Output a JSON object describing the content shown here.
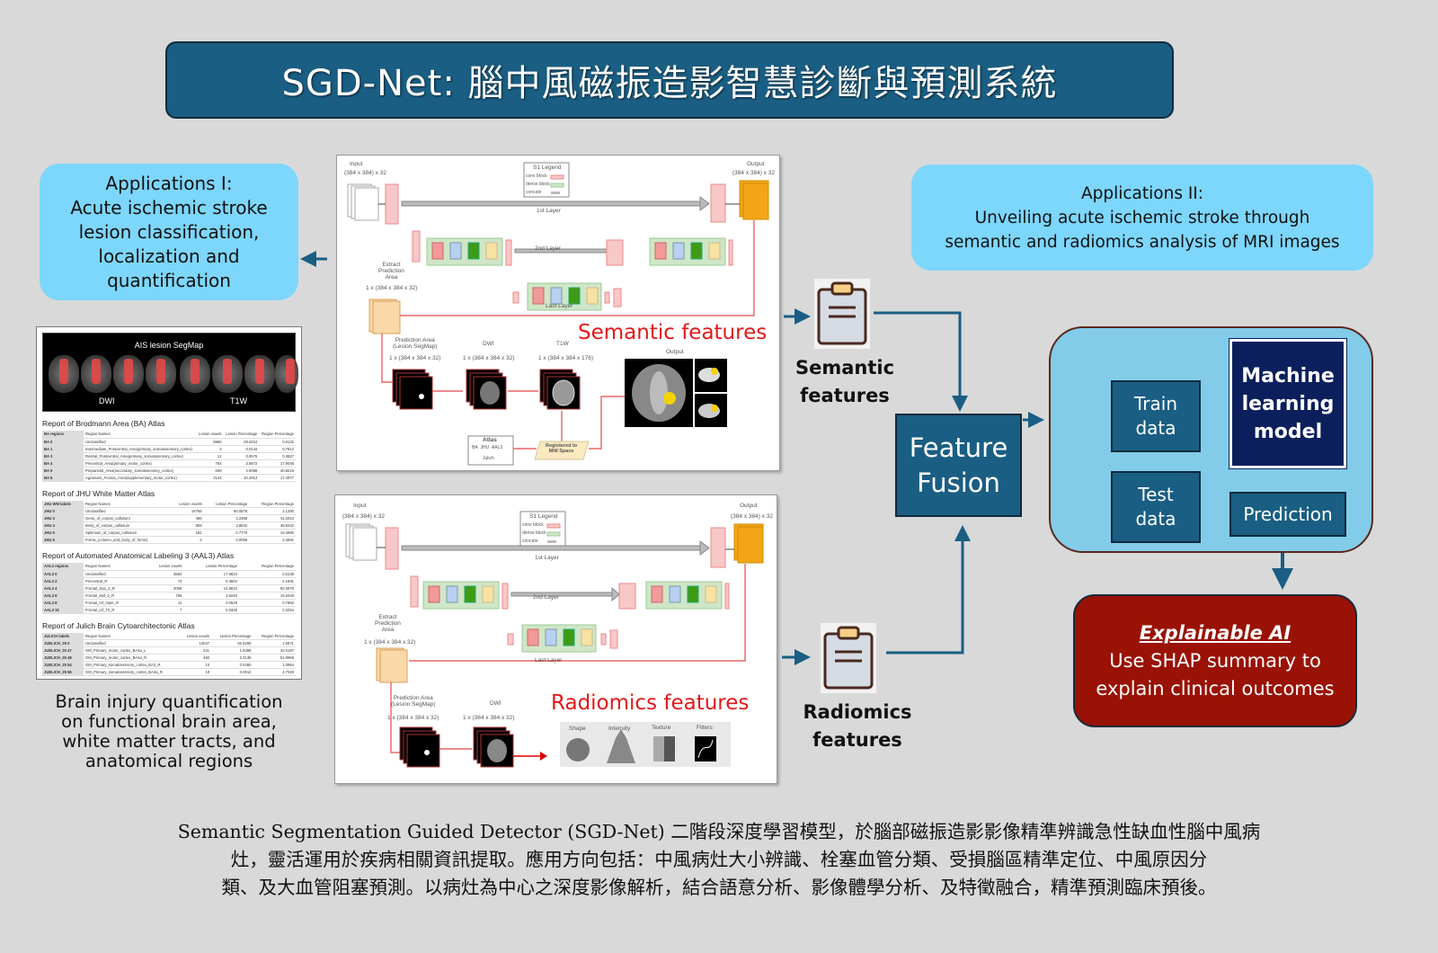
{
  "title": "SGD-Net: 腦中風磁振造影智慧診斷與預測系統",
  "applications_1": {
    "lines": [
      "Applications I:",
      "Acute ischemic stroke",
      "lesion classification,",
      "localization and",
      "quantification"
    ]
  },
  "applications_2": {
    "lines": [
      "Applications II:",
      "Unveiling acute ischemic stroke through",
      "semantic and radiomics analysis of MRI images"
    ]
  },
  "report": {
    "segmap_title": "AIS lesion SegMap",
    "segmap_labels": [
      "DWI",
      "T1W"
    ],
    "tables": [
      {
        "title": "Report of Brodmann Area (BA) Atlas",
        "columns": [
          "BA regions",
          "Region Names",
          "Lesion voxels",
          "Lesion Percentage",
          "Region Percentage"
        ],
        "rows": [
          [
            "BA 0",
            "Unclassified",
            "5965",
            "28.6324",
            "0.8132"
          ],
          [
            "BA 1",
            "Intermediate_Postcentral_Area(primary_somatosensory_cortex)",
            "3",
            "0.0144",
            "0.7812"
          ],
          [
            "BA 3",
            "Rostral_Postcentral_Area(primary_somatosensory_cortex)",
            "12",
            "0.0576",
            "0.3827"
          ],
          [
            "BA 4",
            "Precentral_Area(primary_motor_cortex)",
            "764",
            "3.6672",
            "17.9048"
          ],
          [
            "BA 5",
            "Preparietal_Area(secondary_somatosensory_cortex)",
            "606",
            "2.9088",
            "30.8215"
          ],
          [
            "BA 6",
            "Agranular_Frontal_Area(supplementary_motor_cortex)",
            "2144",
            "10.2913",
            "17.4977"
          ]
        ]
      },
      {
        "title": "Report of JHU White Matter Atlas",
        "columns": [
          "JHU WM labels",
          "Region Names",
          "Lesion voxels",
          "Lesion Percentage",
          "Region Percentage"
        ],
        "rows": [
          [
            "JHU 0",
            "Unclassified",
            "18768",
            "90.0878",
            "2.1290"
          ],
          [
            "JHU 3",
            "Genu_of_corpus_callosum",
            "466",
            "2.2368",
            "41.2024"
          ],
          [
            "JHU 4",
            "Body_of_corpus_callosum",
            "809",
            "3.8832",
            "46.8442"
          ],
          [
            "JHU 5",
            "Splenium_of_corpus_callosum",
            "162",
            "0.7776",
            "10.4990"
          ],
          [
            "JHU 6",
            "Fornix_(column_and_body_of_fornix)",
            "2",
            "0.0096",
            "2.4691"
          ]
        ]
      },
      {
        "title": "Report of Automated Anatomical Labeling 3 (AAL3) Atlas",
        "columns": [
          "AAL3 regions",
          "Region Names",
          "Lesion voxels",
          "Lesion Percentage",
          "Region Percentage"
        ],
        "rows": [
          [
            "AAL3 0",
            "Unclassified",
            "3684",
            "17.6834",
            "0.5138"
          ],
          [
            "AAL3 2",
            "Precentral_R",
            "73",
            "0.3504",
            "2.1591"
          ],
          [
            "AAL3 4",
            "Frontal_Sup_2_R",
            "3096",
            "14.8610",
            "60.3979"
          ],
          [
            "AAL3 6",
            "Frontal_Mid_2_R",
            "755",
            "3.6240",
            "15.5349"
          ],
          [
            "AAL3 8",
            "Frontal_Inf_Oper_R",
            "11",
            "0.0528",
            "0.7862"
          ],
          [
            "AAL3 10",
            "Frontal_Inf_Tri_R",
            "7",
            "0.0336",
            "0.3254"
          ]
        ]
      },
      {
        "title": "Report of Julich Brain Cytoarchitectonic Atlas",
        "columns": [
          "JULICH labels",
          "Region Names",
          "Lesion voxels",
          "Lesion Percentage",
          "Region Percentage"
        ],
        "rows": [
          [
            "JUELICH_25 0",
            "Unclassified",
            "13047",
            "62.6266",
            "1.5971"
          ],
          [
            "JUELICH_25 47",
            "GM_Primary_motor_cortex_BA4a_L",
            "341",
            "1.6368",
            "32.0187"
          ],
          [
            "JUELICH_25 48",
            "GM_Primary_motor_cortex_BA4a_R",
            "482",
            "2.3136",
            "51.9958"
          ],
          [
            "JUELICH_25 54",
            "GM_Primary_somatosensory_cortex_BA2_R",
            "10",
            "0.0480",
            "1.0964"
          ],
          [
            "JUELICH_25 56",
            "GM_Primary_somatosensory_cortex_BA3a_R",
            "19",
            "0.0912",
            "4.7029"
          ]
        ]
      }
    ],
    "caption_lines": [
      "Brain injury quantification",
      "on functional brain area,",
      "white matter tracts, and",
      "anatomical regions"
    ]
  },
  "network": {
    "input_label": "Input",
    "input_dims": "(384 x 384) x 32",
    "output_label": "Output",
    "output_dims": "(384 x 384) x 32",
    "legend_title": "S1 Legend",
    "legend_items": [
      "conv block",
      "dense block",
      "concate"
    ],
    "layers": [
      "1st Layer",
      "2nd Layer",
      "Last Layer"
    ],
    "extract_label": [
      "Extract",
      "Prediction",
      "Area"
    ],
    "extract_dims": "1 x (384 x 384 x 32)"
  },
  "semantic_panel": {
    "heading": "Semantic features",
    "images": [
      {
        "label": "Prediction Area\n(Lesion SegMap)",
        "dims": "1 x (384 x 384 x 32)"
      },
      {
        "label": "DWI",
        "dims": "1 x (384 x 384 x 32)"
      },
      {
        "label": "T1W",
        "dims": "1 x (384 x 384 x 176)"
      }
    ],
    "output_label": "Output",
    "atlas_title": "Atlas",
    "atlas_items": [
      "BA",
      "JHU",
      "AAL3",
      "Julich"
    ],
    "registered_label": [
      "Registered to",
      "MNI Space"
    ]
  },
  "radiomics_panel": {
    "heading": "Radiomics features",
    "images": [
      {
        "label": "Prediction Area\n(Lesion SegMap)",
        "dims": "1 x (384 x 384 x 32)"
      },
      {
        "label": "DWI",
        "dims": "1 x (384 x 384 x 32)"
      }
    ],
    "feature_types": [
      "Shape",
      "Intensity",
      "Texture",
      "Filters"
    ]
  },
  "semantic_features_label": [
    "Semantic",
    "features"
  ],
  "radiomics_features_label": [
    "Radiomics",
    "features"
  ],
  "feature_fusion_label": [
    "Feature",
    "Fusion"
  ],
  "ml": {
    "train_label": [
      "Train",
      "data"
    ],
    "test_label": [
      "Test",
      "data"
    ],
    "model_label": [
      "Machine",
      "learning",
      "model"
    ],
    "prediction_label": "Prediction"
  },
  "xai": {
    "heading": "Explainable AI",
    "lines": [
      "Use SHAP summary to",
      "explain clinical outcomes"
    ]
  },
  "description_lines": [
    "Semantic Segmentation Guided Detector (SGD-Net) 二階段深度學習模型，於腦部磁振造影影像精準辨識急性缺血性腦中風病",
    "灶，靈活運用於疾病相關資訊提取。應用方向包括：中風病灶大小辨識、栓塞血管分類、受損腦區精準定位、中風原因分",
    "類、及大血管阻塞預測。以病灶為中心之深度影像解析，結合語意分析、影像體學分析、及特徵融合，精準預測臨床預後。"
  ],
  "colors": {
    "background": "#d9d9d9",
    "title_bg": "#1a5e83",
    "app_box": "#7dd6fb",
    "ml_group": "#82ccea",
    "ml_model": "#0b1f5c",
    "xai_bg": "#9a1205",
    "feature_red": "#e21818",
    "arrow": "#1a5e83"
  }
}
